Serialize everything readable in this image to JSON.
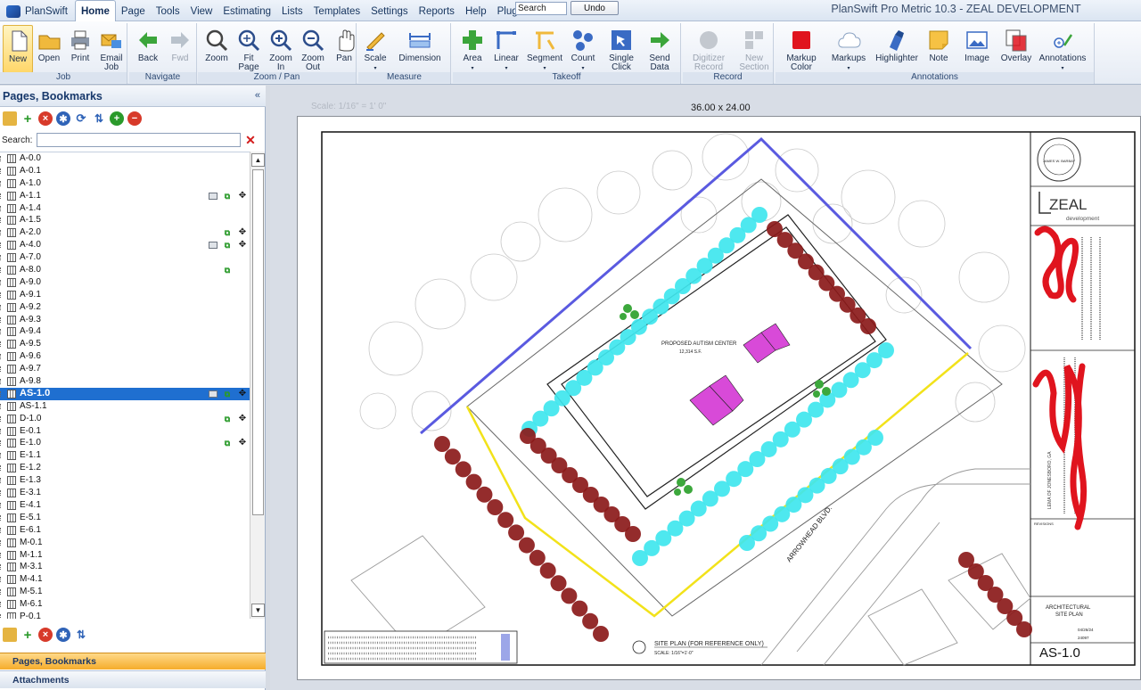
{
  "menu": {
    "app_label": "PlanSwift",
    "items": [
      "Home",
      "Page",
      "Tools",
      "View",
      "Estimating",
      "Lists",
      "Templates",
      "Settings",
      "Reports",
      "Help",
      "Plugins"
    ],
    "active": "Home",
    "search_value": "Search",
    "undo_label": "Undo"
  },
  "window_title": "PlanSwift Pro Metric 10.3 - ZEAL DEVELOPMENT",
  "ribbon": {
    "groups": [
      {
        "label": "Job",
        "buttons": [
          {
            "label": "New",
            "icon": "new-document-icon",
            "selected": true
          },
          {
            "label": "Open",
            "icon": "folder-open-icon"
          },
          {
            "label": "Print",
            "icon": "printer-icon"
          },
          {
            "label": "Email\nJob",
            "icon": "email-icon"
          }
        ]
      },
      {
        "label": "Navigate",
        "buttons": [
          {
            "label": "Back",
            "icon": "arrow-left-icon"
          },
          {
            "label": "Fwd",
            "icon": "arrow-right-icon",
            "disabled": true
          }
        ]
      },
      {
        "label": "Zoom / Pan",
        "buttons": [
          {
            "label": "Zoom",
            "icon": "magnifier-icon"
          },
          {
            "label": "Fit\nPage",
            "icon": "zoom-fit-icon"
          },
          {
            "label": "Zoom\nIn",
            "icon": "zoom-in-icon"
          },
          {
            "label": "Zoom\nOut",
            "icon": "zoom-out-icon"
          },
          {
            "label": "Pan",
            "icon": "hand-icon"
          }
        ]
      },
      {
        "label": "Measure",
        "buttons": [
          {
            "label": "Scale",
            "icon": "scale-icon",
            "dropdown": true
          },
          {
            "label": "Dimension",
            "icon": "dimension-icon"
          }
        ]
      },
      {
        "label": "Takeoff",
        "buttons": [
          {
            "label": "Area",
            "icon": "area-icon",
            "dropdown": true
          },
          {
            "label": "Linear",
            "icon": "linear-icon",
            "dropdown": true
          },
          {
            "label": "Segment",
            "icon": "segment-icon",
            "dropdown": true
          },
          {
            "label": "Count",
            "icon": "count-icon",
            "dropdown": true
          },
          {
            "label": "Single\nClick",
            "icon": "single-click-icon",
            "dropdown": true
          },
          {
            "label": "Send\nData",
            "icon": "send-data-icon",
            "dropdown": true
          }
        ]
      },
      {
        "label": "Record",
        "buttons": [
          {
            "label": "Digitizer\nRecord",
            "icon": "record-icon",
            "disabled": true,
            "dropdown": true
          },
          {
            "label": "New\nSection",
            "icon": "new-section-icon",
            "disabled": true,
            "dropdown": true
          }
        ]
      },
      {
        "label": "Annotations",
        "buttons": [
          {
            "label": "Markup\nColor",
            "icon": "markup-color-icon",
            "dropdown": true
          },
          {
            "label": "Markups",
            "icon": "cloud-icon",
            "dropdown": true
          },
          {
            "label": "Highlighter",
            "icon": "highlighter-icon"
          },
          {
            "label": "Note",
            "icon": "note-icon"
          },
          {
            "label": "Image",
            "icon": "image-icon"
          },
          {
            "label": "Overlay",
            "icon": "overlay-icon"
          },
          {
            "label": "Annotations",
            "icon": "annotations-icon",
            "dropdown": true
          }
        ]
      }
    ]
  },
  "left_panel": {
    "title": "Pages, Bookmarks",
    "search_label": "Search:",
    "search_value": "",
    "pages": [
      {
        "label": "A-0.0"
      },
      {
        "label": "A-0.1"
      },
      {
        "label": "A-1.0"
      },
      {
        "label": "A-1.1",
        "icons": [
          "layout",
          "takeoff",
          "move"
        ]
      },
      {
        "label": "A-1.4"
      },
      {
        "label": "A-1.5"
      },
      {
        "label": "A-2.0",
        "icons": [
          "takeoff",
          "move"
        ]
      },
      {
        "label": "A-4.0",
        "icons": [
          "layout",
          "takeoff",
          "move"
        ]
      },
      {
        "label": "A-7.0"
      },
      {
        "label": "A-8.0",
        "icons": [
          "takeoff"
        ]
      },
      {
        "label": "A-9.0"
      },
      {
        "label": "A-9.1"
      },
      {
        "label": "A-9.2"
      },
      {
        "label": "A-9.3"
      },
      {
        "label": "A-9.4"
      },
      {
        "label": "A-9.5"
      },
      {
        "label": "A-9.6"
      },
      {
        "label": "A-9.7"
      },
      {
        "label": "A-9.8"
      },
      {
        "label": "AS-1.0",
        "selected": true,
        "icons": [
          "layout",
          "takeoff",
          "move"
        ]
      },
      {
        "label": "AS-1.1"
      },
      {
        "label": "D-1.0",
        "icons": [
          "takeoff",
          "move"
        ]
      },
      {
        "label": "E-0.1"
      },
      {
        "label": "E-1.0",
        "icons": [
          "takeoff",
          "move"
        ]
      },
      {
        "label": "E-1.1"
      },
      {
        "label": "E-1.2"
      },
      {
        "label": "E-1.3"
      },
      {
        "label": "E-3.1"
      },
      {
        "label": "E-4.1"
      },
      {
        "label": "E-5.1"
      },
      {
        "label": "E-6.1"
      },
      {
        "label": "M-0.1"
      },
      {
        "label": "M-1.1"
      },
      {
        "label": "M-3.1"
      },
      {
        "label": "M-4.1"
      },
      {
        "label": "M-5.1"
      },
      {
        "label": "M-6.1"
      },
      {
        "label": "P-0.1"
      }
    ],
    "sections": [
      "Pages, Bookmarks",
      "Attachments"
    ]
  },
  "document": {
    "scale_text": "Scale: 1/16\" = 1' 0\"",
    "sheet_size": "36.00 x 24.00",
    "drawing": {
      "center_title": "PROPOSED AUTISM CENTER",
      "center_area": "12,314 S.F.",
      "road_label": "ARROWHEAD BLVD.",
      "plan_title": "SITE PLAN (FOR REFERENCE ONLY)",
      "plan_scale": "SCALE: 1/16\"=1'-0\"",
      "sheet_number": "AS-1.0",
      "sheet_name": "ARCHITECTURAL\nSITE PLAN",
      "company_name": "ZEAL",
      "company_sub": "development",
      "seal_text": "JAMES W. BARBAY",
      "revisions_label": "REVISIONS",
      "date_value": "04/26/24",
      "job_value": "24097",
      "location_text": "LEMA OF JONESBORO, GA"
    },
    "markup_colors": {
      "property_line": "#5a5ae0",
      "boundary": "#f2e21a",
      "new_trees": "#3fe6ee",
      "existing_trees": "#8b1a1a",
      "areas": "#d84ad8",
      "shrubs": "#3ca83c",
      "redaction": "#e0141e"
    }
  }
}
